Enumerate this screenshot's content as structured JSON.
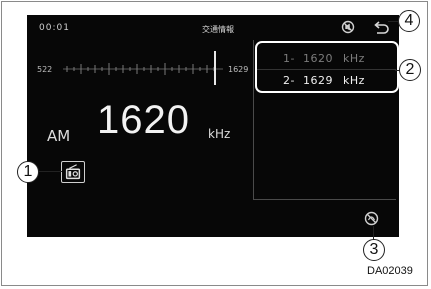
{
  "status": {
    "time": "00:01",
    "title": "交通情報"
  },
  "tuner": {
    "band": "AM",
    "frequency": "1620",
    "unit": "kHz",
    "scale_min": "522",
    "scale_max": "1629"
  },
  "presets": [
    {
      "number": "1-",
      "frequency": "1620",
      "unit": "kHz"
    },
    {
      "number": "2-",
      "frequency": "1629",
      "unit": "kHz"
    }
  ],
  "callouts": {
    "c1": "1",
    "c2": "2",
    "c3": "3",
    "c4": "4"
  },
  "figure_code": "DA02039",
  "icons": {
    "mute": "mute-icon",
    "back": "back-arrow-icon",
    "radio": "radio-icon",
    "traffic": "traffic-info-icon"
  }
}
